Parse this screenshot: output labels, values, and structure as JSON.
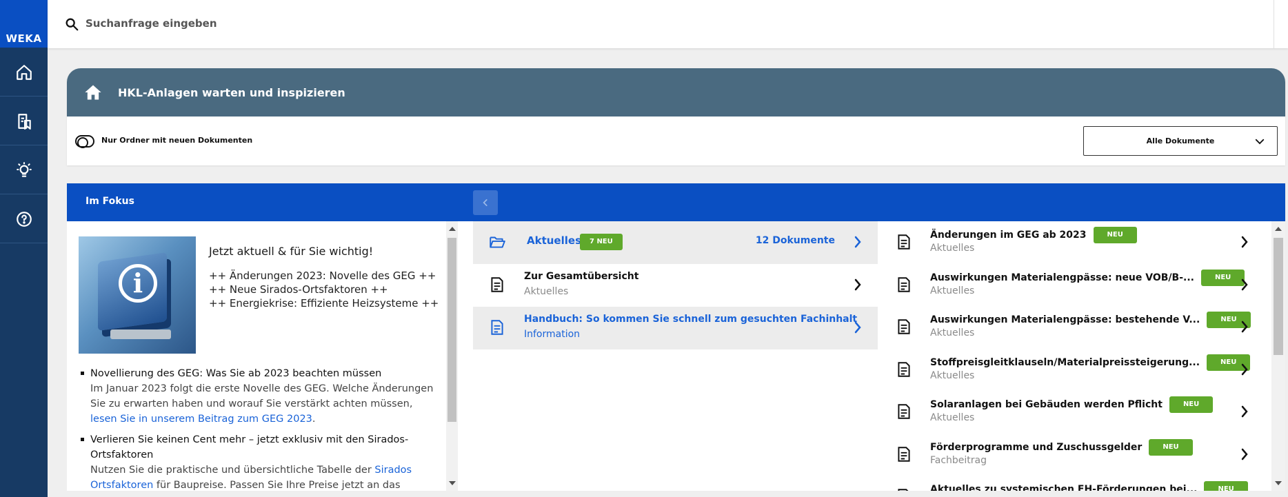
{
  "brand": {
    "logo_text": "WEKA"
  },
  "sidebar": {
    "items": [
      {
        "name": "home",
        "icon": "home-icon"
      },
      {
        "name": "documents",
        "icon": "document-bookmark-icon"
      },
      {
        "name": "ideas",
        "icon": "lightbulb-icon"
      },
      {
        "name": "help",
        "icon": "help-icon"
      }
    ]
  },
  "search": {
    "placeholder": "Suchanfrage eingeben"
  },
  "folder": {
    "title": "HKL-Anlagen warten und inspizieren",
    "toggle_label": "Nur Ordner mit neuen Dokumenten",
    "filter_selected": "Alle Dokumente"
  },
  "fokus": {
    "title": "Im Fokus",
    "intro_title": "Jetzt aktuell & für Sie wichtig!",
    "intro_lines": [
      "++ Änderungen 2023: Novelle des GEG ++",
      "++ Neue Sirados-Ortsfaktoren ++",
      "++ Energiekrise: Effiziente Heizsysteme ++"
    ],
    "bullets": [
      {
        "title": "Novellierung des GEG: Was Sie ab 2023 beachten müssen",
        "body": "Im Januar 2023 folgt die erste Novelle des GEG. Welche Änderungen Sie zu erwarten haben und worauf Sie verstärkt achten müssen,",
        "link": "lesen Sie in unserem Beitrag zum GEG 2023",
        "after": "."
      },
      {
        "title": "Verlieren Sie keinen Cent mehr – jetzt exklusiv mit den Sirados-Ortsfaktoren",
        "body": "Nutzen Sie die praktische und übersichtliche Tabelle der",
        "link": "Sirados Ortsfaktoren",
        "after": "für Baupreise. Passen Sie Ihre Preise jetzt an das regionale"
      }
    ]
  },
  "middle": {
    "folder_row": {
      "title": "Aktuelles",
      "badge": "7 NEU",
      "count": "12 Dokumente"
    },
    "rows": [
      {
        "title": "Zur Gesamtübersicht",
        "subtitle": "Aktuelles"
      },
      {
        "title": "Handbuch: So kommen Sie schnell zum gesuchten Fachinhalt",
        "subtitle": "Information"
      }
    ]
  },
  "right": {
    "rows": [
      {
        "title": "Änderungen im GEG ab 2023",
        "subtitle": "Aktuelles",
        "badge": "NEU"
      },
      {
        "title": "Auswirkungen Materialengpässe: neue VOB/B-...",
        "subtitle": "Aktuelles",
        "badge": "NEU"
      },
      {
        "title": "Auswirkungen Materialengpässe: bestehende V...",
        "subtitle": "Aktuelles",
        "badge": "NEU"
      },
      {
        "title": "Stoffpreisgleitklauseln/Materialpreissteigerung...",
        "subtitle": "Aktuelles",
        "badge": "NEU"
      },
      {
        "title": "Solaranlagen bei Gebäuden werden Pflicht",
        "subtitle": "Aktuelles",
        "badge": "NEU"
      },
      {
        "title": "Förderprogramme und Zuschussgelder",
        "subtitle": "Fachbeitrag",
        "badge": "NEU"
      },
      {
        "title": "Aktuelles zu systemischen EH-Förderungen bei...",
        "subtitle": "",
        "badge": "NEU"
      }
    ]
  },
  "colors": {
    "brand_blue": "#0a4fc2",
    "sidebar_navy": "#173a64",
    "folder_header": "#4a6a80",
    "new_badge": "#5fa92b",
    "link_blue": "#1a63d8"
  }
}
